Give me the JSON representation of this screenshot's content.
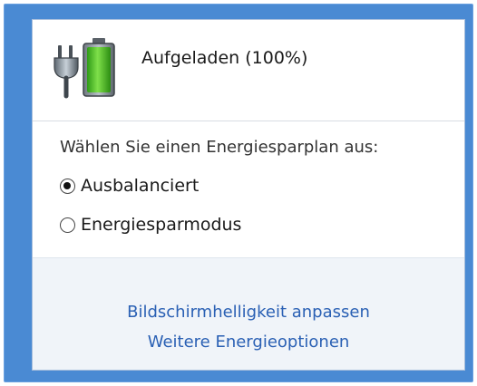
{
  "battery": {
    "status_text": "Aufgeladen (100%)",
    "charge_percent": 100,
    "icon": "battery-plugged-icon",
    "fill_color": "#4cc22c"
  },
  "power_plan": {
    "prompt": "Wählen Sie einen Energiesparplan aus:",
    "options": [
      {
        "label": "Ausbalanciert",
        "selected": true
      },
      {
        "label": "Energiesparmodus",
        "selected": false
      }
    ]
  },
  "links": {
    "brightness": "Bildschirmhelligkeit anpassen",
    "more_options": "Weitere Energieoptionen"
  },
  "colors": {
    "frame": "#4a8ad3",
    "link": "#2a60b4",
    "footer_bg": "#f0f4f9"
  }
}
